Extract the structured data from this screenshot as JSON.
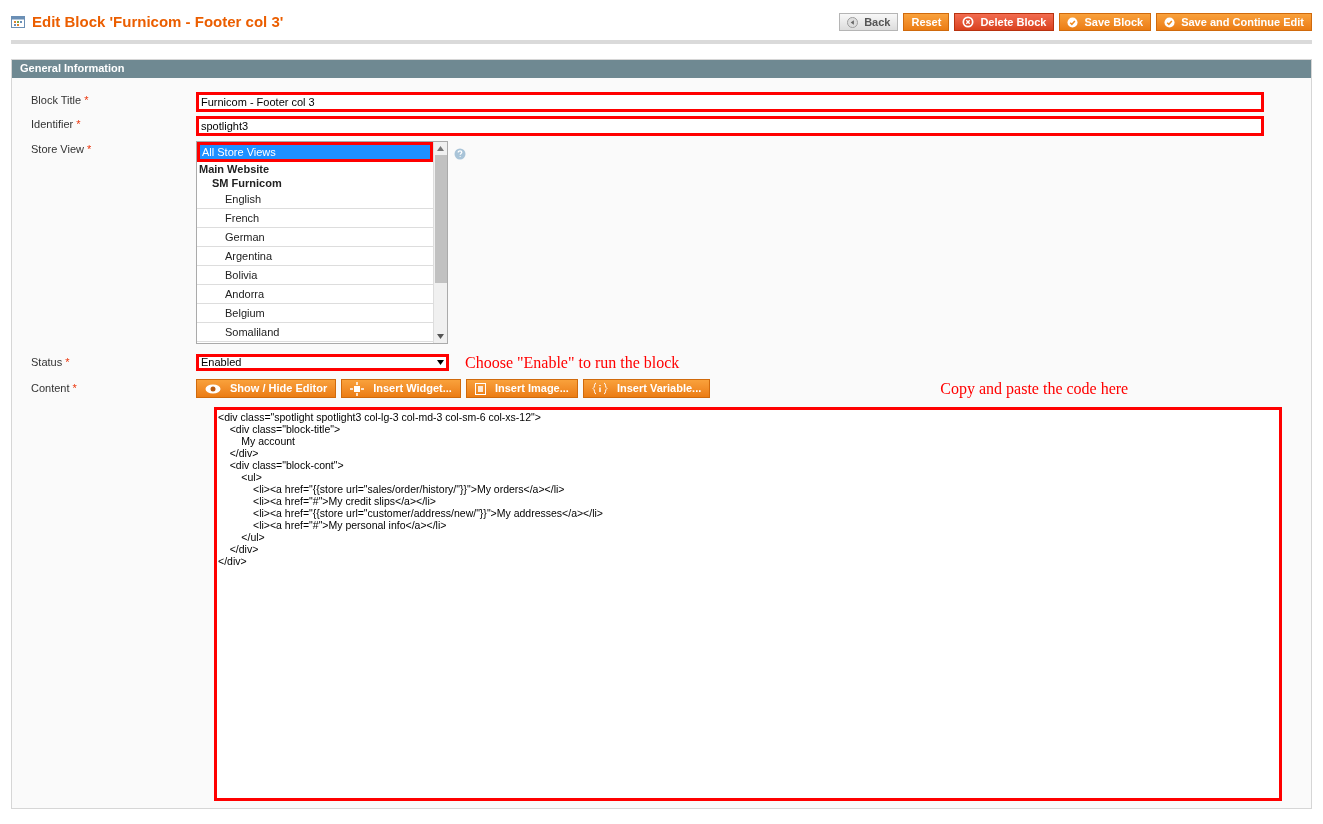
{
  "page_title": "Edit Block 'Furnicom - Footer col 3'",
  "actions": [
    {
      "label": "Back",
      "kind": "back"
    },
    {
      "label": "Reset",
      "kind": "plain"
    },
    {
      "label": "Delete Block",
      "kind": "delete"
    },
    {
      "label": "Save Block",
      "kind": "save"
    },
    {
      "label": "Save and Continue Edit",
      "kind": "save"
    }
  ],
  "section": {
    "title": "General Information",
    "block_title": {
      "label": "Block Title",
      "required_mark": "*",
      "value": "Furnicom - Footer col 3"
    },
    "identifier": {
      "label": "Identifier",
      "required_mark": "*",
      "value": "spotlight3"
    },
    "store_view": {
      "label": "Store View",
      "required_mark": "*",
      "options": [
        {
          "label": "All Store Views",
          "kind": "option",
          "selected": true
        },
        {
          "label": "Main Website",
          "kind": "group",
          "children": [
            {
              "label": "SM Furnicom",
              "kind": "group",
              "children": [
                {
                  "label": "English",
                  "kind": "option",
                  "selected": false
                },
                {
                  "label": "French",
                  "kind": "option",
                  "selected": false
                },
                {
                  "label": "German",
                  "kind": "option",
                  "selected": false
                },
                {
                  "label": "Argentina",
                  "kind": "option",
                  "selected": false
                },
                {
                  "label": "Bolivia",
                  "kind": "option",
                  "selected": false
                },
                {
                  "label": "Andorra",
                  "kind": "option",
                  "selected": false
                },
                {
                  "label": "Belgium",
                  "kind": "option",
                  "selected": false
                },
                {
                  "label": "Somaliland",
                  "kind": "option",
                  "selected": false
                }
              ]
            }
          ]
        }
      ]
    },
    "status": {
      "label": "Status",
      "required_mark": "*",
      "value": "Enabled",
      "note": "Choose \"Enable\" to run the block"
    },
    "content": {
      "label": "Content",
      "required_mark": "*",
      "note": "Copy and paste the code here",
      "editor_buttons": [
        {
          "label": "Show / Hide Editor",
          "kind": "eye"
        },
        {
          "label": "Insert Widget...",
          "kind": "widget"
        },
        {
          "label": "Insert Image...",
          "kind": "image"
        },
        {
          "label": "Insert Variable...",
          "kind": "variable"
        }
      ],
      "value": "<div class=\"spotlight spotlight3 col-lg-3 col-md-3 col-sm-6 col-xs-12\">\n\t<div class=\"block-title\">\n\t\tMy account\n\t</div>\n\t<div class=\"block-cont\">\n\t\t<ul>\n\t\t\t<li><a href=\"{{store url=\"sales/order/history/\"}}\">My orders</a></li>\n\t\t\t<li><a href=\"#\">My credit slips</a></li>\n\t\t\t<li><a href=\"{{store url=\"customer/address/new/\"}}\">My addresses</a></li>\n\t\t\t<li><a href=\"#\">My personal info</a></li>\n\t\t</ul>\n\t</div>\n</div>"
    }
  }
}
